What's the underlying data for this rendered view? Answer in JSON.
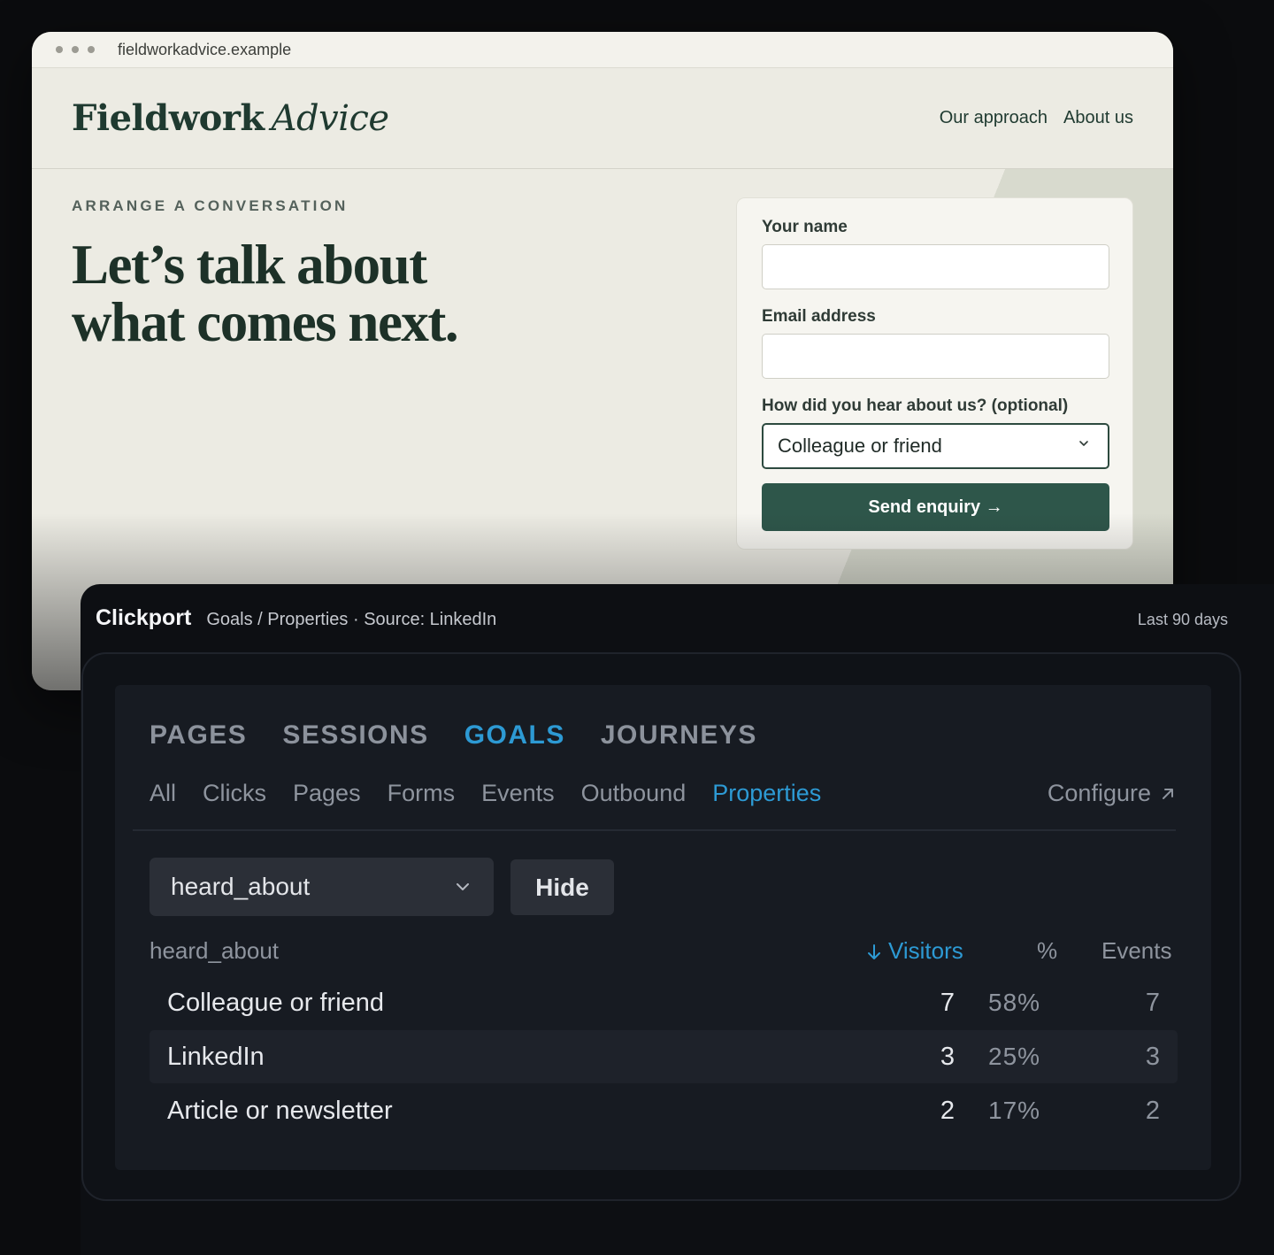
{
  "browser": {
    "url": "fieldworkadvice.example"
  },
  "site": {
    "logo_bold": "Fieldwork",
    "logo_italic": "Advice",
    "nav": [
      "Our approach",
      "About us"
    ],
    "eyebrow": "ARRANGE A CONVERSATION",
    "headline_line1": "Let’s talk about",
    "headline_line2": "what comes next.",
    "form": {
      "name_label": "Your name",
      "email_label": "Email address",
      "source_label": "How did you hear about us? (optional)",
      "source_value": "Colleague or friend",
      "submit_label": "Send enquiry →"
    },
    "colors": {
      "brand": "#1f3a30",
      "button": "#2e564a"
    }
  },
  "clickport": {
    "brand": "Clickport",
    "breadcrumb": "Goals / Properties · Source: LinkedIn",
    "range": "Last 90 days",
    "tabs": [
      "PAGES",
      "SESSIONS",
      "GOALS",
      "JOURNEYS"
    ],
    "active_tab": "GOALS",
    "subtabs": [
      "All",
      "Clicks",
      "Pages",
      "Forms",
      "Events",
      "Outbound",
      "Properties"
    ],
    "active_subtab": "Properties",
    "configure_label": "Configure",
    "property_select": "heard_about",
    "hide_label": "Hide",
    "table": {
      "columns": [
        "heard_about",
        "Visitors",
        "%",
        "Events"
      ],
      "sort_column": "Visitors",
      "rows": [
        {
          "name": "Colleague or friend",
          "visitors": "7",
          "pct": "58%",
          "events": "7"
        },
        {
          "name": "LinkedIn",
          "visitors": "3",
          "pct": "25%",
          "events": "3"
        },
        {
          "name": "Article or newsletter",
          "visitors": "2",
          "pct": "17%",
          "events": "2"
        }
      ]
    },
    "colors": {
      "accent": "#2d9ad4"
    }
  }
}
